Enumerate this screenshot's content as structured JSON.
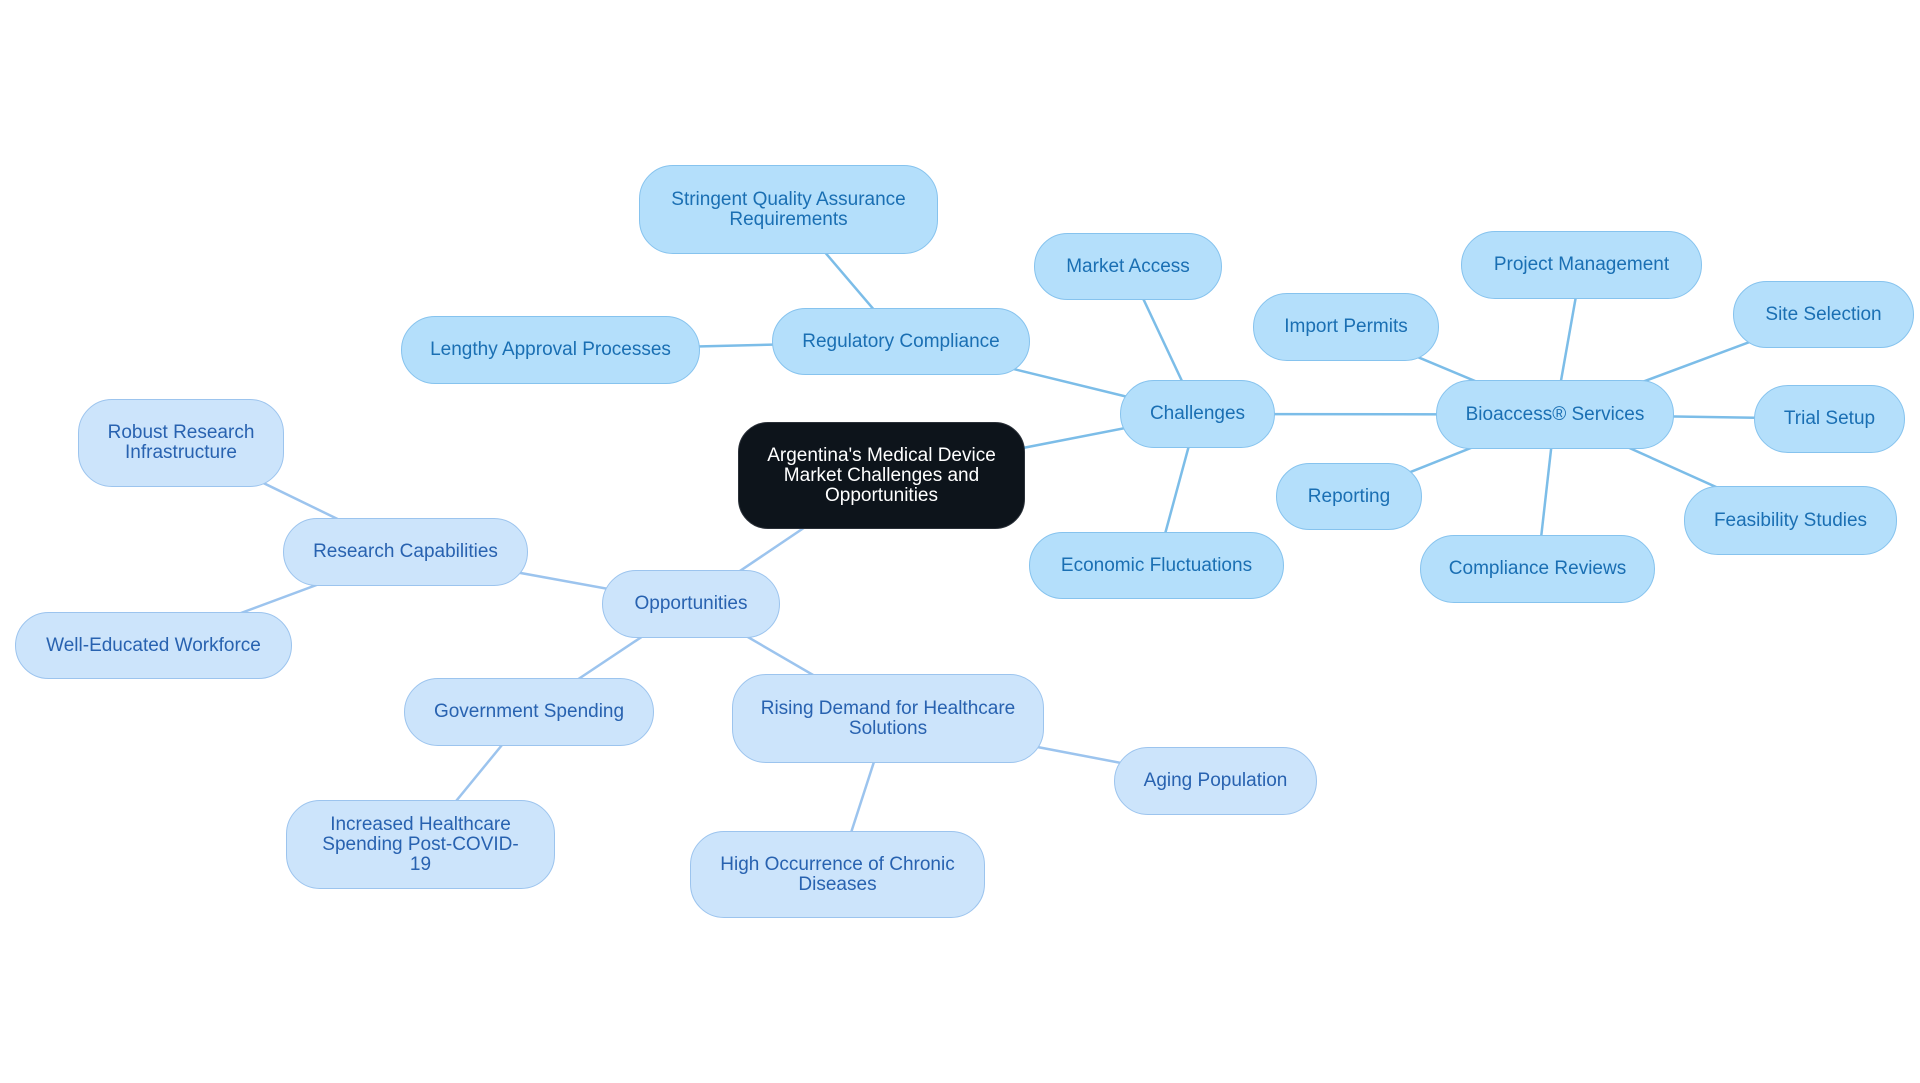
{
  "diagram": {
    "type": "mind-map",
    "colors": {
      "root_fill": "#0d141b",
      "root_text": "#ffffff",
      "challenge_fill": "#b4dffb",
      "challenge_border": "#86c3ee",
      "challenge_text": "#1a6fb3",
      "challenge_edge": "#7cbde8",
      "opportunity_fill": "#cce4fb",
      "opportunity_border": "#9cc4ee",
      "opportunity_text": "#2862b0",
      "opportunity_edge": "#9cc4ee"
    },
    "nodes": {
      "root": {
        "label": "Argentina's Medical Device Market Challenges and Opportunities"
      },
      "challenges": {
        "label": "Challenges"
      },
      "regulatory_compliance": {
        "label": "Regulatory Compliance"
      },
      "stringent_qa": {
        "label": "Stringent Quality Assurance Requirements"
      },
      "lengthy_approval": {
        "label": "Lengthy Approval Processes"
      },
      "market_access": {
        "label": "Market Access"
      },
      "economic_fluctuations": {
        "label": "Economic Fluctuations"
      },
      "bioaccess_services": {
        "label": "Bioaccess® Services"
      },
      "import_permits": {
        "label": "Import Permits"
      },
      "project_management": {
        "label": "Project Management"
      },
      "site_selection": {
        "label": "Site Selection"
      },
      "trial_setup": {
        "label": "Trial Setup"
      },
      "feasibility_studies": {
        "label": "Feasibility Studies"
      },
      "compliance_reviews": {
        "label": "Compliance Reviews"
      },
      "reporting": {
        "label": "Reporting"
      },
      "opportunities": {
        "label": "Opportunities"
      },
      "research_capabilities": {
        "label": "Research Capabilities"
      },
      "robust_research": {
        "label": "Robust Research Infrastructure"
      },
      "well_educated": {
        "label": "Well-Educated Workforce"
      },
      "government_spending": {
        "label": "Government Spending"
      },
      "increased_healthcare": {
        "label": "Increased Healthcare Spending Post-COVID-19"
      },
      "rising_demand": {
        "label": "Rising Demand for Healthcare Solutions"
      },
      "aging_population": {
        "label": "Aging Population"
      },
      "chronic_diseases": {
        "label": "High Occurrence of Chronic Diseases"
      }
    },
    "edges": [
      [
        "root",
        "challenges"
      ],
      [
        "root",
        "opportunities"
      ],
      [
        "challenges",
        "regulatory_compliance"
      ],
      [
        "regulatory_compliance",
        "stringent_qa"
      ],
      [
        "regulatory_compliance",
        "lengthy_approval"
      ],
      [
        "challenges",
        "market_access"
      ],
      [
        "challenges",
        "economic_fluctuations"
      ],
      [
        "challenges",
        "bioaccess_services"
      ],
      [
        "bioaccess_services",
        "import_permits"
      ],
      [
        "bioaccess_services",
        "project_management"
      ],
      [
        "bioaccess_services",
        "site_selection"
      ],
      [
        "bioaccess_services",
        "trial_setup"
      ],
      [
        "bioaccess_services",
        "feasibility_studies"
      ],
      [
        "bioaccess_services",
        "compliance_reviews"
      ],
      [
        "bioaccess_services",
        "reporting"
      ],
      [
        "opportunities",
        "research_capabilities"
      ],
      [
        "research_capabilities",
        "robust_research"
      ],
      [
        "research_capabilities",
        "well_educated"
      ],
      [
        "opportunities",
        "government_spending"
      ],
      [
        "government_spending",
        "increased_healthcare"
      ],
      [
        "opportunities",
        "rising_demand"
      ],
      [
        "rising_demand",
        "aging_population"
      ],
      [
        "rising_demand",
        "chronic_diseases"
      ]
    ]
  }
}
